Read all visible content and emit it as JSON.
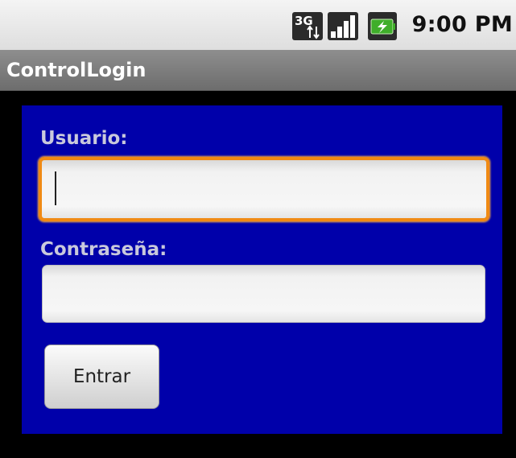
{
  "status_bar": {
    "network_icon": "3g-icon",
    "network_label": "3G",
    "signal_icon": "signal-icon",
    "battery_icon": "battery-charging-icon",
    "time": "9:00 PM"
  },
  "title_bar": {
    "title": "ControlLogin"
  },
  "form": {
    "username_label": "Usuario:",
    "username_value": "",
    "password_label": "Contraseña:",
    "password_value": "",
    "submit_label": "Entrar"
  },
  "colors": {
    "panel_background": "#0000aa",
    "focus_border": "#f08a14",
    "screen_background": "#000000"
  }
}
